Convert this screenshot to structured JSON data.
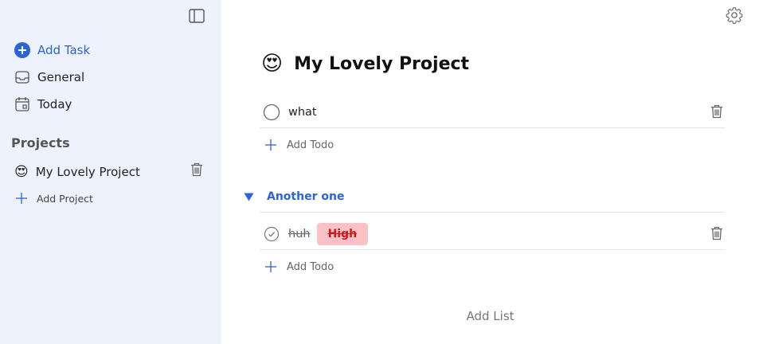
{
  "sidebar": {
    "toggle_icon": "sidebar-toggle-icon",
    "nav": [
      {
        "label": "Add Task",
        "icon": "plus-circle-icon",
        "accent": "#2b63d9"
      },
      {
        "label": "General",
        "icon": "inbox-icon"
      },
      {
        "label": "Today",
        "icon": "calendar-icon"
      }
    ],
    "projects_heading": "Projects",
    "projects": [
      {
        "label": "My Lovely Project",
        "emoji": "😍"
      }
    ],
    "add_project_label": "Add Project"
  },
  "main": {
    "settings_icon": "gear-icon",
    "project_emoji": "😍",
    "project_title": "My Lovely Project",
    "default_list": {
      "todos": [
        {
          "text": "what",
          "done": false
        }
      ],
      "add_todo_label": "Add Todo"
    },
    "lists": [
      {
        "name": "Another one",
        "expanded": true,
        "todos": [
          {
            "text": "huh",
            "done": true,
            "priority": "High",
            "priority_color": "#d8141e",
            "priority_bg": "#f9c2c4"
          }
        ],
        "add_todo_label": "Add Todo"
      }
    ],
    "add_list_label": "Add List"
  }
}
